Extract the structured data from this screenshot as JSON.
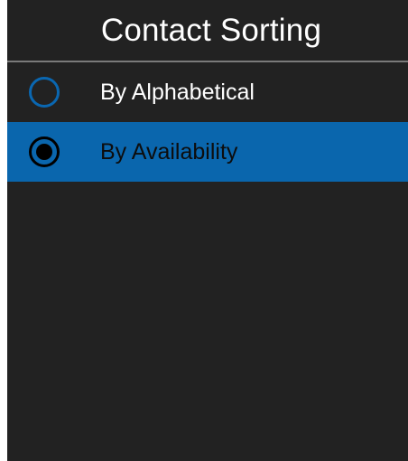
{
  "header": {
    "title": "Contact Sorting"
  },
  "options": [
    {
      "label": "By Alphabetical",
      "selected": false
    },
    {
      "label": "By Availability",
      "selected": true
    }
  ],
  "colors": {
    "background": "#222222",
    "accent": "#0a66ad",
    "radio_ring": "#0a67b1",
    "divider": "#7a7a7a"
  }
}
